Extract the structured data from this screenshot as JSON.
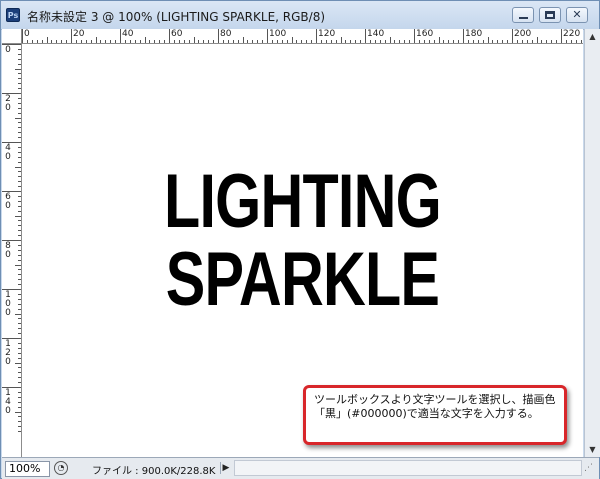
{
  "window": {
    "title": "名称未設定 3 @ 100% (LIGHTING SPARKLE, RGB/8)",
    "app_icon_text": "Ps"
  },
  "window_controls": {
    "close_glyph": "✕"
  },
  "rulers": {
    "top_labels": [
      "0",
      "20",
      "40",
      "60",
      "80",
      "100",
      "120",
      "140",
      "160",
      "180",
      "200",
      "220"
    ],
    "left_labels": [
      "0",
      "20",
      "40",
      "60",
      "80",
      "100",
      "120",
      "140"
    ]
  },
  "canvas": {
    "line1": "LIGHTING",
    "line2": "SPARKLE",
    "text_color": "#000000"
  },
  "scrollbar": {
    "up": "▲",
    "down": "▼"
  },
  "statusbar": {
    "zoom": "100%",
    "file_info": "ファイル : 900.0K/228.8K",
    "menu_arrow": "▶",
    "info_icon": "◔",
    "grip": "⋰"
  },
  "callout": {
    "text": "ツールボックスより文字ツールを選択し、描画色「黒」(#000000)で適当な文字を入力する。",
    "border_color": "#d8262a"
  }
}
